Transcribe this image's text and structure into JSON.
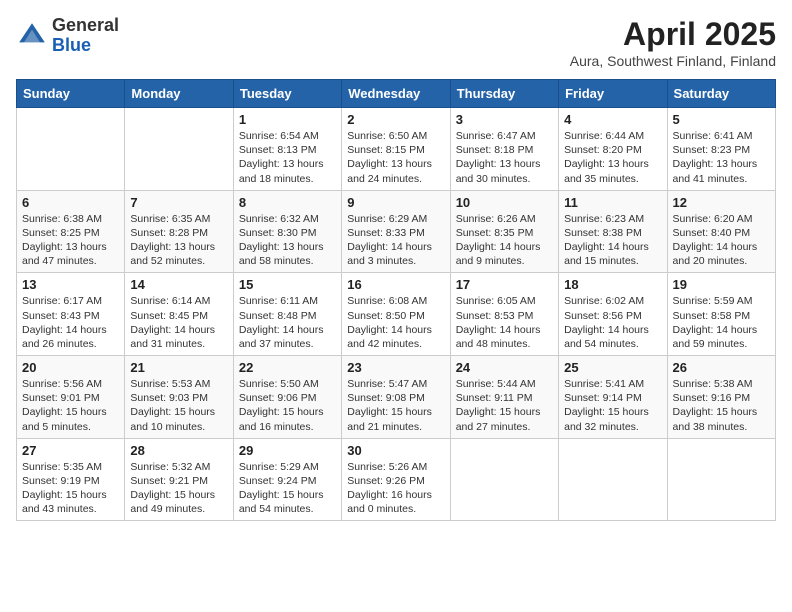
{
  "logo": {
    "general": "General",
    "blue": "Blue"
  },
  "title": "April 2025",
  "location": "Aura, Southwest Finland, Finland",
  "days_of_week": [
    "Sunday",
    "Monday",
    "Tuesday",
    "Wednesday",
    "Thursday",
    "Friday",
    "Saturday"
  ],
  "weeks": [
    [
      {
        "day": "",
        "info": ""
      },
      {
        "day": "",
        "info": ""
      },
      {
        "day": "1",
        "info": "Sunrise: 6:54 AM\nSunset: 8:13 PM\nDaylight: 13 hours and 18 minutes."
      },
      {
        "day": "2",
        "info": "Sunrise: 6:50 AM\nSunset: 8:15 PM\nDaylight: 13 hours and 24 minutes."
      },
      {
        "day": "3",
        "info": "Sunrise: 6:47 AM\nSunset: 8:18 PM\nDaylight: 13 hours and 30 minutes."
      },
      {
        "day": "4",
        "info": "Sunrise: 6:44 AM\nSunset: 8:20 PM\nDaylight: 13 hours and 35 minutes."
      },
      {
        "day": "5",
        "info": "Sunrise: 6:41 AM\nSunset: 8:23 PM\nDaylight: 13 hours and 41 minutes."
      }
    ],
    [
      {
        "day": "6",
        "info": "Sunrise: 6:38 AM\nSunset: 8:25 PM\nDaylight: 13 hours and 47 minutes."
      },
      {
        "day": "7",
        "info": "Sunrise: 6:35 AM\nSunset: 8:28 PM\nDaylight: 13 hours and 52 minutes."
      },
      {
        "day": "8",
        "info": "Sunrise: 6:32 AM\nSunset: 8:30 PM\nDaylight: 13 hours and 58 minutes."
      },
      {
        "day": "9",
        "info": "Sunrise: 6:29 AM\nSunset: 8:33 PM\nDaylight: 14 hours and 3 minutes."
      },
      {
        "day": "10",
        "info": "Sunrise: 6:26 AM\nSunset: 8:35 PM\nDaylight: 14 hours and 9 minutes."
      },
      {
        "day": "11",
        "info": "Sunrise: 6:23 AM\nSunset: 8:38 PM\nDaylight: 14 hours and 15 minutes."
      },
      {
        "day": "12",
        "info": "Sunrise: 6:20 AM\nSunset: 8:40 PM\nDaylight: 14 hours and 20 minutes."
      }
    ],
    [
      {
        "day": "13",
        "info": "Sunrise: 6:17 AM\nSunset: 8:43 PM\nDaylight: 14 hours and 26 minutes."
      },
      {
        "day": "14",
        "info": "Sunrise: 6:14 AM\nSunset: 8:45 PM\nDaylight: 14 hours and 31 minutes."
      },
      {
        "day": "15",
        "info": "Sunrise: 6:11 AM\nSunset: 8:48 PM\nDaylight: 14 hours and 37 minutes."
      },
      {
        "day": "16",
        "info": "Sunrise: 6:08 AM\nSunset: 8:50 PM\nDaylight: 14 hours and 42 minutes."
      },
      {
        "day": "17",
        "info": "Sunrise: 6:05 AM\nSunset: 8:53 PM\nDaylight: 14 hours and 48 minutes."
      },
      {
        "day": "18",
        "info": "Sunrise: 6:02 AM\nSunset: 8:56 PM\nDaylight: 14 hours and 54 minutes."
      },
      {
        "day": "19",
        "info": "Sunrise: 5:59 AM\nSunset: 8:58 PM\nDaylight: 14 hours and 59 minutes."
      }
    ],
    [
      {
        "day": "20",
        "info": "Sunrise: 5:56 AM\nSunset: 9:01 PM\nDaylight: 15 hours and 5 minutes."
      },
      {
        "day": "21",
        "info": "Sunrise: 5:53 AM\nSunset: 9:03 PM\nDaylight: 15 hours and 10 minutes."
      },
      {
        "day": "22",
        "info": "Sunrise: 5:50 AM\nSunset: 9:06 PM\nDaylight: 15 hours and 16 minutes."
      },
      {
        "day": "23",
        "info": "Sunrise: 5:47 AM\nSunset: 9:08 PM\nDaylight: 15 hours and 21 minutes."
      },
      {
        "day": "24",
        "info": "Sunrise: 5:44 AM\nSunset: 9:11 PM\nDaylight: 15 hours and 27 minutes."
      },
      {
        "day": "25",
        "info": "Sunrise: 5:41 AM\nSunset: 9:14 PM\nDaylight: 15 hours and 32 minutes."
      },
      {
        "day": "26",
        "info": "Sunrise: 5:38 AM\nSunset: 9:16 PM\nDaylight: 15 hours and 38 minutes."
      }
    ],
    [
      {
        "day": "27",
        "info": "Sunrise: 5:35 AM\nSunset: 9:19 PM\nDaylight: 15 hours and 43 minutes."
      },
      {
        "day": "28",
        "info": "Sunrise: 5:32 AM\nSunset: 9:21 PM\nDaylight: 15 hours and 49 minutes."
      },
      {
        "day": "29",
        "info": "Sunrise: 5:29 AM\nSunset: 9:24 PM\nDaylight: 15 hours and 54 minutes."
      },
      {
        "day": "30",
        "info": "Sunrise: 5:26 AM\nSunset: 9:26 PM\nDaylight: 16 hours and 0 minutes."
      },
      {
        "day": "",
        "info": ""
      },
      {
        "day": "",
        "info": ""
      },
      {
        "day": "",
        "info": ""
      }
    ]
  ]
}
